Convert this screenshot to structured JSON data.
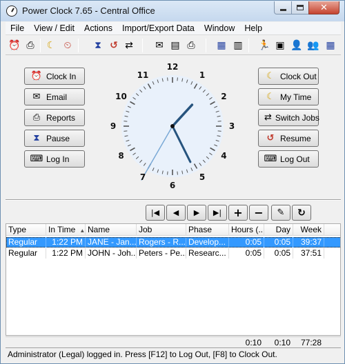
{
  "window": {
    "title": "Power Clock 7.65 - Central Office"
  },
  "menu": [
    "File",
    "View / Edit",
    "Actions",
    "Import/Export Data",
    "Window",
    "Help"
  ],
  "toolbar_icons": [
    "alarm-clock-icon",
    "printer-icon",
    "moon-clock-icon",
    "clock-out-icon",
    "hourglass-icon",
    "reset-clock-icon",
    "switch-jobs-icon",
    "email-icon",
    "reports-icon",
    "print-preview-icon",
    "calendar-icon",
    "calculator-icon",
    "runner-icon",
    "schedule-icon",
    "manager-icon",
    "users-icon",
    "timecard-icon"
  ],
  "left_buttons": [
    {
      "label": "Clock In",
      "icon": "alarm-clock-icon"
    },
    {
      "label": "Email",
      "icon": "envelope-icon"
    },
    {
      "label": "Reports",
      "icon": "printer-icon"
    },
    {
      "label": "Pause",
      "icon": "hourglass-icon"
    },
    {
      "label": "Log In",
      "icon": "login-icon"
    }
  ],
  "right_buttons": [
    {
      "label": "Clock Out",
      "icon": "moon-clock-icon"
    },
    {
      "label": "My Time",
      "icon": "my-time-icon"
    },
    {
      "label": "Switch Jobs",
      "icon": "switch-jobs-icon"
    },
    {
      "label": "Resume",
      "icon": "resume-icon"
    },
    {
      "label": "Log Out",
      "icon": "logout-icon"
    }
  ],
  "clock": {
    "numerals": [
      "12",
      "1",
      "2",
      "3",
      "4",
      "5",
      "6",
      "7",
      "8",
      "9",
      "10",
      "11"
    ],
    "time": {
      "hours": 1,
      "minutes": 25,
      "seconds": 35
    }
  },
  "nav_buttons": [
    "|◀",
    "◀",
    "▶",
    "▶|",
    "+",
    "−",
    "edit",
    "refresh"
  ],
  "grid": {
    "columns": [
      "Type",
      "In Time",
      "Name",
      "Job",
      "Phase",
      "Hours (...",
      "Day",
      "Week"
    ],
    "rows": [
      [
        "Regular",
        "1:22 PM",
        "JANE - Jan...",
        "Rogers - R...",
        "Develop...",
        "0:05",
        "0:05",
        "39:37"
      ],
      [
        "Regular",
        "1:22 PM",
        "JOHN - Joh...",
        "Peters - Pe...",
        "Researc...",
        "0:05",
        "0:05",
        "37:51"
      ]
    ],
    "selected_row": 0
  },
  "totals": {
    "hours": "0:10",
    "day": "0:10",
    "week": "77:28"
  },
  "status": "Administrator (Legal) logged in.  Press [F12] to Log Out, [F8] to Clock Out."
}
